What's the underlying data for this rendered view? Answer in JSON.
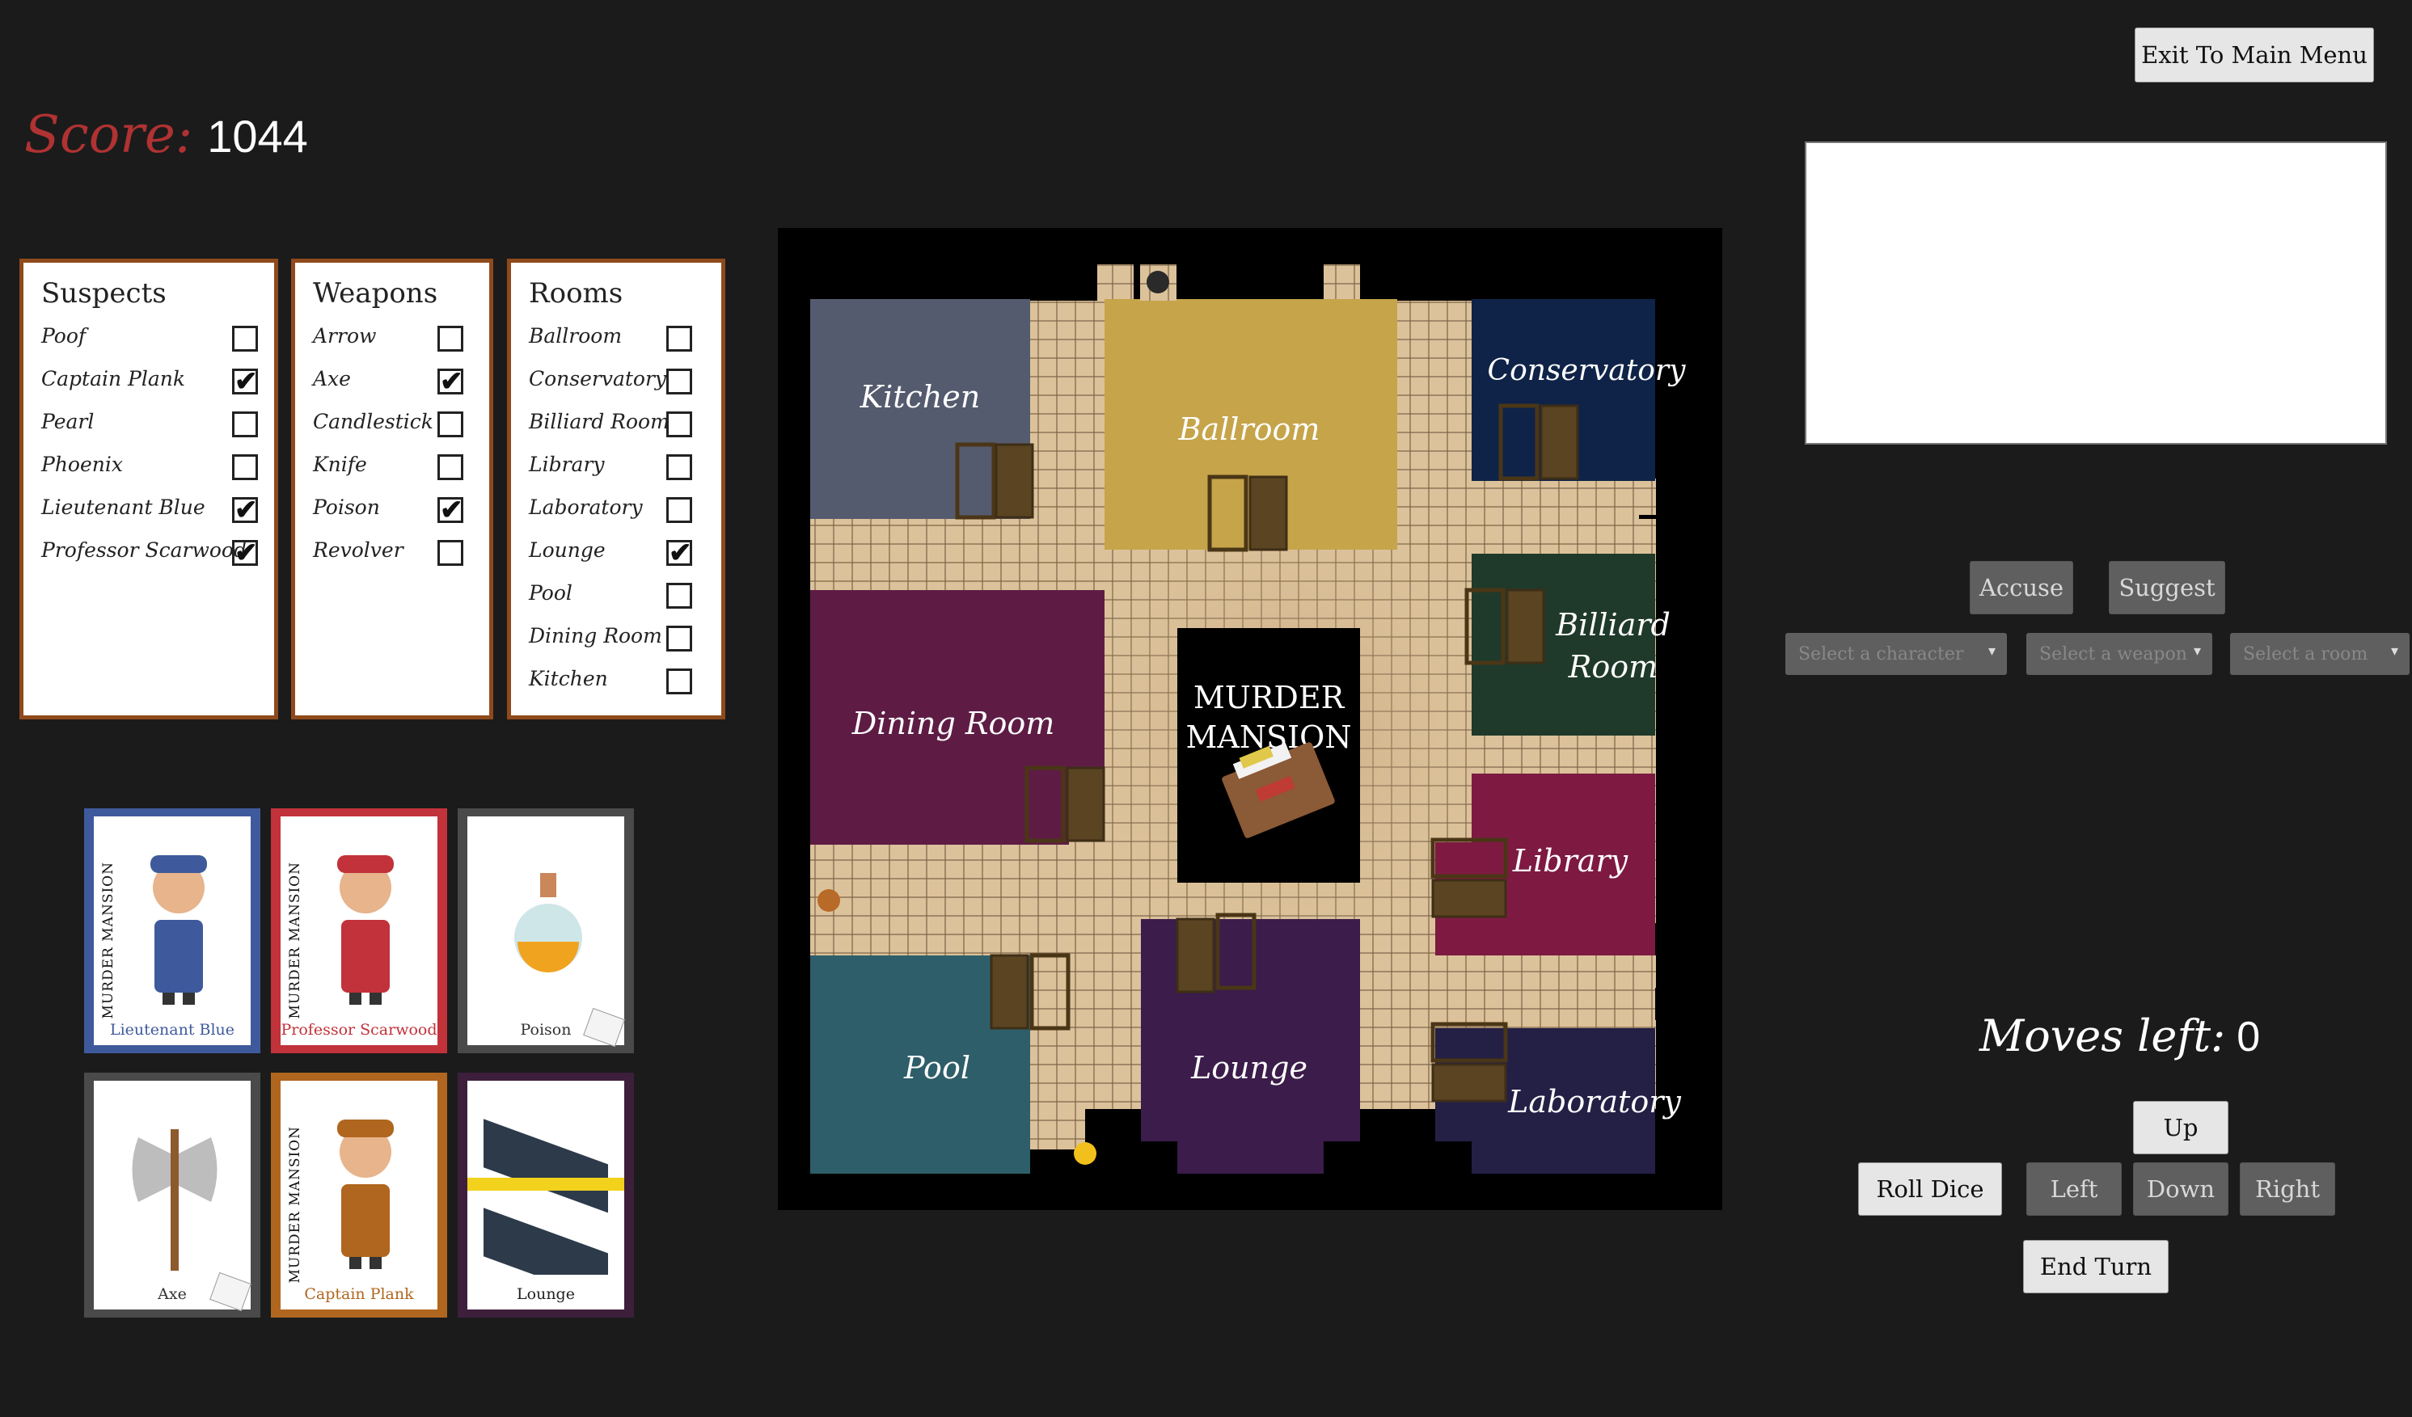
{
  "header": {
    "exit_label": "Exit To Main Menu"
  },
  "score": {
    "label": "Score:",
    "value": "1044"
  },
  "checklists": {
    "suspects": {
      "title": "Suspects",
      "items": [
        {
          "label": "Poof",
          "checked": false
        },
        {
          "label": "Captain Plank",
          "checked": true
        },
        {
          "label": "Pearl",
          "checked": false
        },
        {
          "label": "Phoenix",
          "checked": false
        },
        {
          "label": "Lieutenant Blue",
          "checked": true
        },
        {
          "label": "Professor Scarwood",
          "checked": true
        }
      ]
    },
    "weapons": {
      "title": "Weapons",
      "items": [
        {
          "label": "Arrow",
          "checked": false
        },
        {
          "label": "Axe",
          "checked": true
        },
        {
          "label": "Candlestick",
          "checked": false
        },
        {
          "label": "Knife",
          "checked": false
        },
        {
          "label": "Poison",
          "checked": true
        },
        {
          "label": "Revolver",
          "checked": false
        }
      ]
    },
    "rooms": {
      "title": "Rooms",
      "items": [
        {
          "label": "Ballroom",
          "checked": false
        },
        {
          "label": "Conservatory",
          "checked": false
        },
        {
          "label": "Billiard Room",
          "checked": false
        },
        {
          "label": "Library",
          "checked": false
        },
        {
          "label": "Laboratory",
          "checked": false
        },
        {
          "label": "Lounge",
          "checked": true
        },
        {
          "label": "Pool",
          "checked": false
        },
        {
          "label": "Dining Room",
          "checked": false
        },
        {
          "label": "Kitchen",
          "checked": false
        }
      ]
    }
  },
  "cards": [
    {
      "name": "Lieutenant Blue",
      "kind": "suspect",
      "border": "#3f5a9c",
      "caption_color": "#3f5a9c",
      "side": "MURDER MANSION"
    },
    {
      "name": "Professor Scarwood",
      "kind": "suspect",
      "border": "#c2323a",
      "caption_color": "#c2323a",
      "side": "MURDER MANSION"
    },
    {
      "name": "Poison",
      "kind": "weapon",
      "border": "#4a4a4a",
      "caption_color": "#333333",
      "side": ""
    },
    {
      "name": "Axe",
      "kind": "weapon",
      "border": "#4a4a4a",
      "caption_color": "#333333",
      "side": ""
    },
    {
      "name": "Captain Plank",
      "kind": "suspect",
      "border": "#b0661e",
      "caption_color": "#b0661e",
      "side": "MURDER MANSION"
    },
    {
      "name": "Lounge",
      "kind": "room",
      "border": "#3d1f3b",
      "caption_color": "#222222",
      "side": ""
    }
  ],
  "board": {
    "center_title_1": "MURDER",
    "center_title_2": "MANSION",
    "rooms": [
      {
        "name": "Kitchen",
        "color": "#555b6e"
      },
      {
        "name": "Ballroom",
        "color": "#c6a44a"
      },
      {
        "name": "Conservatory",
        "color": "#0f2348"
      },
      {
        "name": "Billiard",
        "name2": "Room",
        "color": "#1f3a2a"
      },
      {
        "name": "Dining Room",
        "color": "#5e1c45"
      },
      {
        "name": "Library",
        "color": "#7e1a42"
      },
      {
        "name": "Pool",
        "color": "#2e5e6a"
      },
      {
        "name": "Lounge",
        "color": "#3b1c4a"
      },
      {
        "name": "Laboratory",
        "color": "#241f45"
      }
    ]
  },
  "actions": {
    "accuse_label": "Accuse",
    "suggest_label": "Suggest",
    "select_character": "Select a character",
    "select_weapon": "Select a weapon",
    "select_room": "Select a room"
  },
  "moves": {
    "label": "Moves left:",
    "value": "0"
  },
  "controls": {
    "up": "Up",
    "left": "Left",
    "down": "Down",
    "right": "Right",
    "roll": "Roll Dice",
    "end_turn": "End Turn"
  }
}
